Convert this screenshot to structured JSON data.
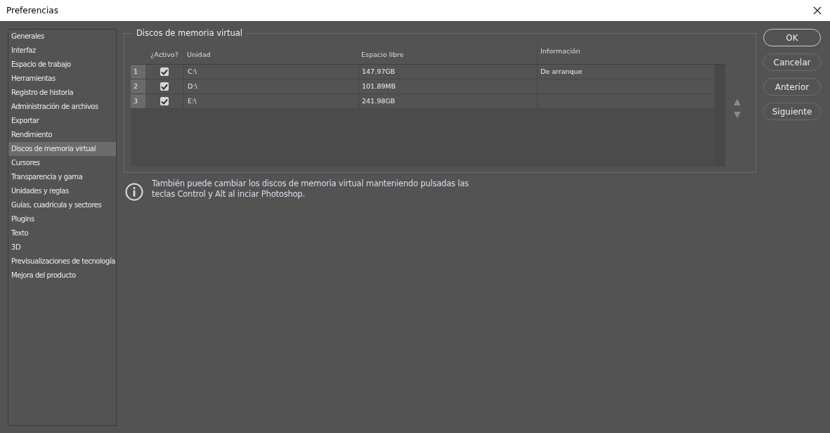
{
  "window": {
    "title": "Preferencias"
  },
  "sidebar": {
    "items": [
      {
        "label": "Generales",
        "selected": false
      },
      {
        "label": "Interfaz",
        "selected": false
      },
      {
        "label": "Espacio de trabajo",
        "selected": false
      },
      {
        "label": "Herramientas",
        "selected": false
      },
      {
        "label": "Registro de historia",
        "selected": false
      },
      {
        "label": "Administración de archivos",
        "selected": false
      },
      {
        "label": "Exportar",
        "selected": false
      },
      {
        "label": "Rendimiento",
        "selected": false
      },
      {
        "label": "Discos de memoria virtual",
        "selected": true
      },
      {
        "label": "Cursores",
        "selected": false
      },
      {
        "label": "Transparencia y gama",
        "selected": false
      },
      {
        "label": "Unidades y reglas",
        "selected": false
      },
      {
        "label": "Guías, cuadrícula y sectores",
        "selected": false
      },
      {
        "label": "Plugins",
        "selected": false
      },
      {
        "label": "Texto",
        "selected": false
      },
      {
        "label": "3D",
        "selected": false
      },
      {
        "label": "Previsualizaciones de tecnología",
        "selected": false
      },
      {
        "label": "Mejora del producto",
        "selected": false
      }
    ]
  },
  "panel": {
    "title": "Discos de memoria virtual",
    "table": {
      "columns": [
        "¿Activo?",
        "Unidad",
        "Espacio libre",
        "Información"
      ],
      "rows": [
        {
          "number": "1",
          "checked": true,
          "drive": "C:\\",
          "free": "147.97GB",
          "info": "De arranque"
        },
        {
          "number": "2",
          "checked": true,
          "drive": "D:\\",
          "free": "101.89MB"
        },
        {
          "number": "3",
          "checked": true,
          "drive": "E:\\",
          "free": "241.98GB"
        }
      ]
    },
    "note": "También puede cambiar los discos de memoria virtual manteniendo pulsadas las teclas Control y Alt al inciar Photoshop."
  },
  "buttons": [
    "OK",
    "Cancelar",
    "Anterior",
    "Siguiente"
  ]
}
